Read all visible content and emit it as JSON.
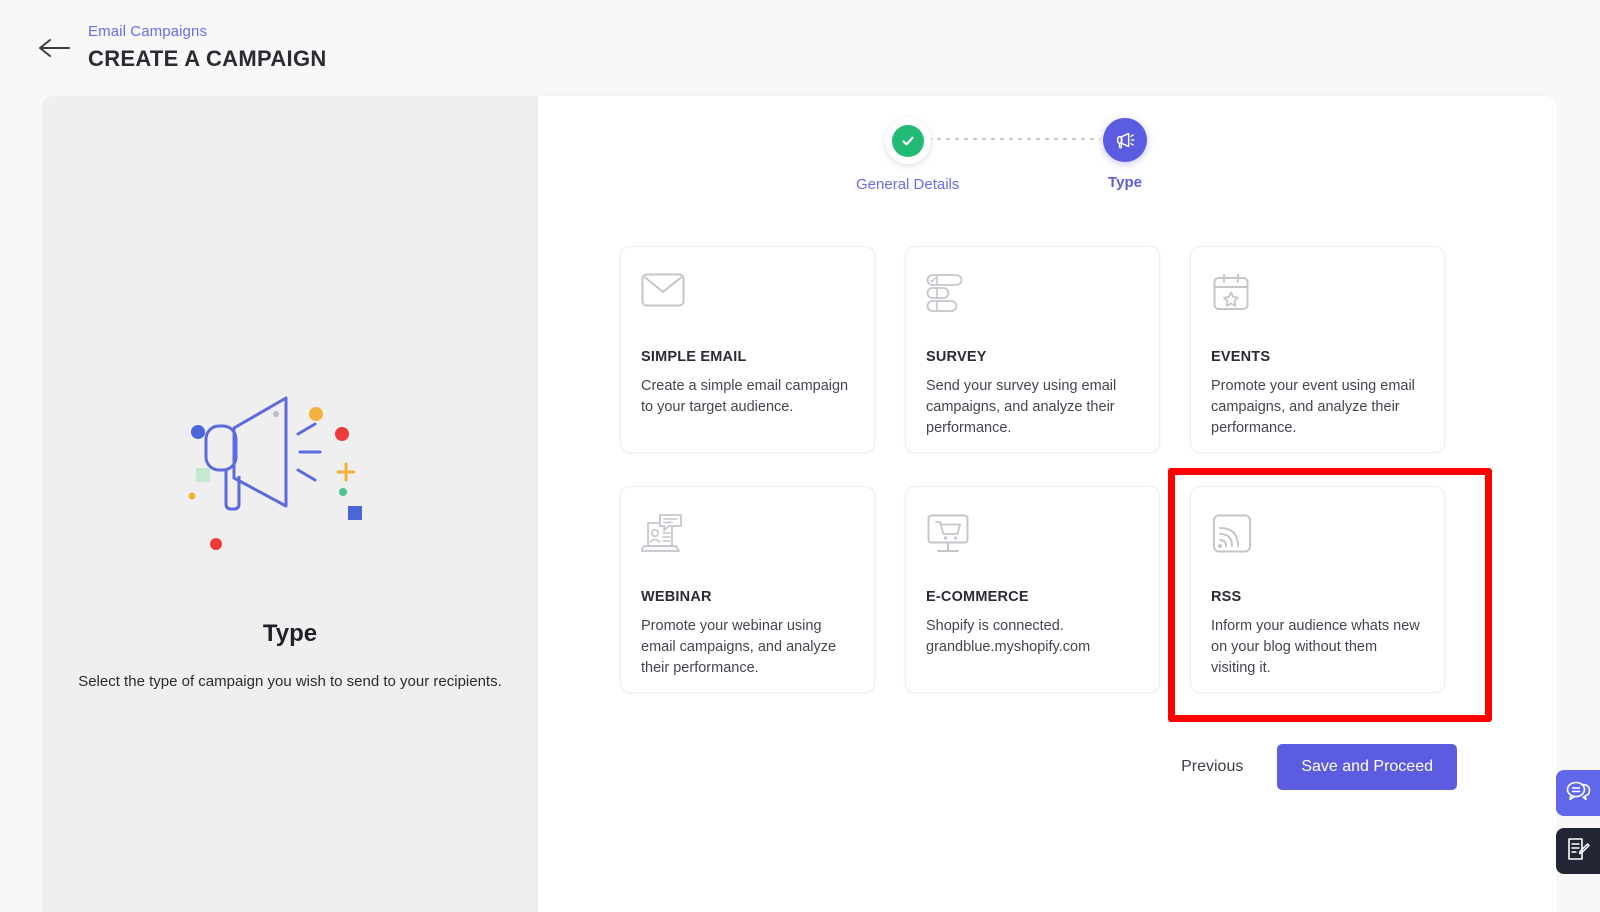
{
  "header": {
    "back_icon": "arrow-left-icon",
    "breadcrumb": "Email Campaigns",
    "title": "CREATE A CAMPAIGN"
  },
  "left_panel": {
    "illustration_icon": "megaphone-illustration",
    "heading": "Type",
    "subtitle": "Select the type of campaign you wish to send to your recipients."
  },
  "stepper": {
    "steps": [
      {
        "label": "General Details",
        "state": "completed",
        "icon": "check-icon"
      },
      {
        "label": "Type",
        "state": "current",
        "icon": "megaphone-icon"
      }
    ]
  },
  "cards": [
    {
      "id": "simple-email",
      "icon": "envelope-icon",
      "title": "SIMPLE EMAIL",
      "desc": "Create a simple email campaign to your target audience.",
      "highlighted": false
    },
    {
      "id": "survey",
      "icon": "survey-list-icon",
      "title": "SURVEY",
      "desc": "Send your survey using email campaigns, and analyze their performance.",
      "highlighted": false
    },
    {
      "id": "events",
      "icon": "calendar-star-icon",
      "title": "EVENTS",
      "desc": "Promote your event using email campaigns, and analyze their performance.",
      "highlighted": false
    },
    {
      "id": "webinar",
      "icon": "laptop-person-icon",
      "title": "WEBINAR",
      "desc": "Promote your webinar using email campaigns, and analyze their performance.",
      "highlighted": false
    },
    {
      "id": "e-commerce",
      "icon": "monitor-cart-icon",
      "title": "E-COMMERCE",
      "desc": "Shopify is connected. grandblue.myshopify.com",
      "highlighted": false
    },
    {
      "id": "rss",
      "icon": "rss-cast-icon",
      "title": "RSS",
      "desc": "Inform your audience whats new on your blog without them visiting it.",
      "highlighted": true
    }
  ],
  "footer": {
    "previous_label": "Previous",
    "save_label": "Save and Proceed"
  },
  "fabs": [
    {
      "id": "chat",
      "icon": "chat-bubbles-icon",
      "color": "#6067e8"
    },
    {
      "id": "note",
      "icon": "note-edit-icon",
      "color": "#222634"
    }
  ],
  "colors": {
    "accent": "#5c5ce0",
    "link": "#6c6ced",
    "success": "#22bb76",
    "highlight": "#fe0000",
    "panel_left_bg": "#efefef",
    "page_bg": "#f8f8f9"
  }
}
